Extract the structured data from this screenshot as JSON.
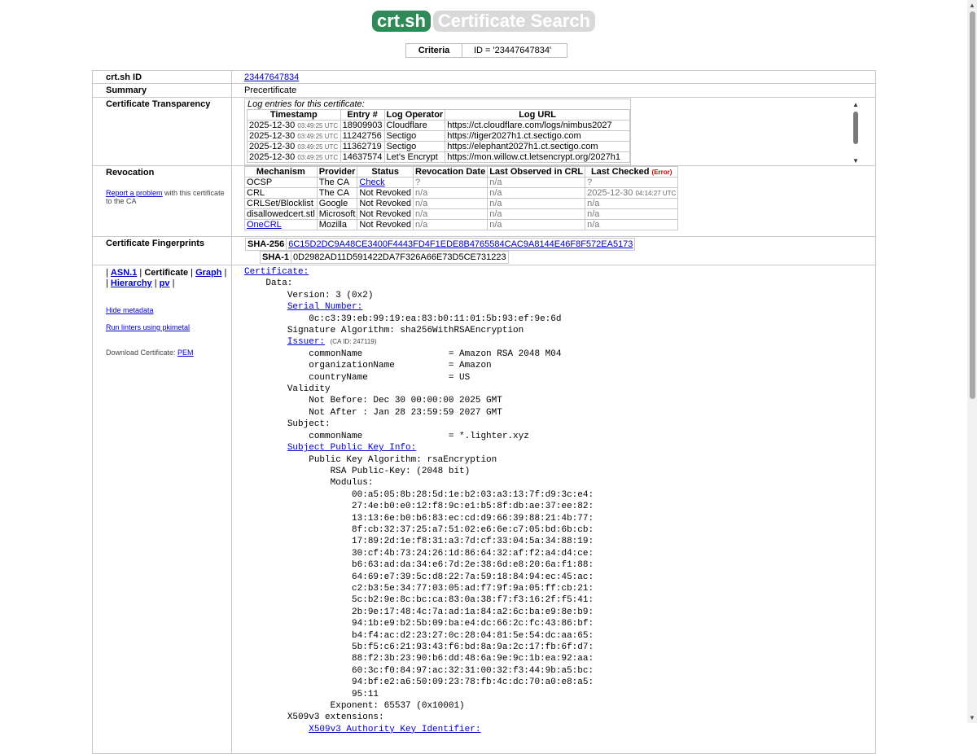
{
  "header": {
    "logo": "crt.sh",
    "title": "Certificate Search"
  },
  "criteria": {
    "label": "Criteria",
    "value": "ID = '23447647834'"
  },
  "rows": {
    "id_label": "crt.sh ID",
    "id_value": "23447647834",
    "summary_label": "Summary",
    "summary_value": "Precertificate",
    "ct_label": "Certificate Transparency",
    "revocation_label": "Revocation",
    "fingerprints_label": "Certificate Fingerprints"
  },
  "ct": {
    "caption": "Log entries for this certificate:",
    "headers": [
      "Timestamp",
      "Entry #",
      "Log Operator",
      "Log URL"
    ],
    "entries": [
      {
        "date": "2025-12-30",
        "time": "03:49:25 UTC",
        "entry": "18909903",
        "operator": "Cloudflare",
        "url": "https://ct.cloudflare.com/logs/nimbus2027"
      },
      {
        "date": "2025-12-30",
        "time": "03:49:25 UTC",
        "entry": "11242756",
        "operator": "Sectigo",
        "url": "https://tiger2027h1.ct.sectigo.com"
      },
      {
        "date": "2025-12-30",
        "time": "03:49:25 UTC",
        "entry": "11362719",
        "operator": "Sectigo",
        "url": "https://elephant2027h1.ct.sectigo.com"
      },
      {
        "date": "2025-12-30",
        "time": "03:49:25 UTC",
        "entry": "14637574",
        "operator": "Let's Encrypt",
        "url": "https://mon.willow.ct.letsencrypt.org/2027h1"
      }
    ]
  },
  "revocation": {
    "report_link": "Report a problem",
    "report_text": " with this certificate to the CA",
    "headers": [
      "Mechanism",
      "Provider",
      "Status",
      "Revocation Date",
      "Last Observed in CRL",
      "Last Checked"
    ],
    "error_label": "(Error)",
    "rows": [
      {
        "mechanism": "OCSP",
        "provider": "The CA",
        "status": "Check",
        "rev_date": "?",
        "last_observed": "n/a",
        "last_checked": "?",
        "last_checked_time": ""
      },
      {
        "mechanism": "CRL",
        "provider": "The CA",
        "status": "Not Revoked",
        "rev_date": "n/a",
        "last_observed": "n/a",
        "last_checked": "2025-12-30",
        "last_checked_time": "04:14:27 UTC"
      },
      {
        "mechanism": "CRLSet/Blocklist",
        "provider": "Google",
        "status": "Not Revoked",
        "rev_date": "n/a",
        "last_observed": "n/a",
        "last_checked": "n/a",
        "last_checked_time": ""
      },
      {
        "mechanism": "disallowedcert.stl",
        "provider": "Microsoft",
        "status": "Not Revoked",
        "rev_date": "n/a",
        "last_observed": "n/a",
        "last_checked": "n/a",
        "last_checked_time": ""
      },
      {
        "mechanism": "OneCRL",
        "provider": "Mozilla",
        "status": "Not Revoked",
        "rev_date": "n/a",
        "last_observed": "n/a",
        "last_checked": "n/a",
        "last_checked_time": ""
      }
    ]
  },
  "fingerprints": {
    "sha256_label": "SHA-256",
    "sha256": "6C15D2DC9A48CE3400F4443FD4F1EDE8B4765584CAC9A8144E46F8F572EA5173",
    "sha1_label": "SHA-1",
    "sha1": "0D2982AD11D591422DA7F326A66E73D5CE731223"
  },
  "side": {
    "asn1": "ASN.1",
    "certificate": "Certificate",
    "graph": "Graph",
    "hierarchy": "Hierarchy",
    "pv": "pv",
    "hide_metadata": "Hide metadata",
    "run_linters": "Run linters using pkimetal",
    "download_label": "Download Certificate: ",
    "pem": "PEM"
  },
  "cert": {
    "certificate_link": "Certificate:",
    "data": "Data:",
    "version": "Version: 3 (0x2)",
    "serial_link": "Serial Number:",
    "serial": "0c:c3:39:eb:99:19:ea:83:b0:11:01:5b:93:ef:9e:6d",
    "sig_alg": "Signature Algorithm: sha256WithRSAEncryption",
    "issuer_link": "Issuer:",
    "issuer_ca_id": "(CA ID: 247119)",
    "issuer_cn": "commonName                = Amazon RSA 2048 M04",
    "issuer_org": "organizationName          = Amazon",
    "issuer_country": "countryName               = US",
    "validity": "Validity",
    "not_before": "Not Before: Dec 30 00:00:00 2025 GMT",
    "not_after": "Not After : Jan 28 23:59:59 2027 GMT",
    "subject": "Subject:",
    "subject_cn": "commonName                = *.lighter.xyz",
    "spki_link": "Subject Public Key Info:",
    "pk_alg": "Public Key Algorithm: rsaEncryption",
    "rsa": "RSA Public-Key: (2048 bit)",
    "modulus": "Modulus:",
    "modulus_lines": [
      "00:a5:05:8b:28:5d:1e:b2:03:a3:13:7f:d9:3c:e4:",
      "27:4e:b0:e0:12:f8:9c:e1:b5:8f:db:ae:37:ee:82:",
      "13:13:6e:b0:b6:83:ec:cd:d9:66:39:88:21:4b:77:",
      "8f:cb:32:37:25:a7:51:02:e6:6e:c7:05:bd:6b:cb:",
      "17:89:2d:1e:f8:31:a3:7d:cf:33:04:5a:34:88:19:",
      "30:cf:4b:73:24:26:1d:86:64:32:af:f2:a4:d4:ce:",
      "b6:63:ad:da:34:e6:7d:2e:38:6d:e8:20:6a:f1:88:",
      "64:69:e7:39:5c:d8:22:7a:59:18:84:94:ec:45:ac:",
      "c2:b3:5e:34:77:03:05:ad:f7:9f:9a:05:ff:cb:21:",
      "5c:b2:9e:8c:bc:ca:83:0a:38:f7:f3:16:2f:f5:41:",
      "2b:9e:17:48:4c:7a:ad:1a:84:a2:6c:ba:e9:8e:b9:",
      "94:1b:e9:b2:5b:09:ba:e4:dc:66:2c:fc:43:86:bf:",
      "b4:f4:ac:d2:23:27:0c:28:04:81:5e:54:dc:aa:65:",
      "5b:f5:c6:21:93:43:f6:bd:8a:9a:2c:17:fb:6f:d7:",
      "88:f2:3b:23:90:b6:dd:48:6a:9e:9c:1b:ea:92:aa:",
      "60:3c:f0:84:97:ac:32:31:00:32:f3:44:9b:a5:bc:",
      "94:bf:e2:a6:50:09:23:78:fb:4c:dc:70:a0:e8:a5:",
      "95:11"
    ],
    "exponent": "Exponent: 65537 (0x10001)",
    "x509v3": "X509v3 extensions:",
    "aki_link": "X509v3 Authority Key Identifier:"
  }
}
